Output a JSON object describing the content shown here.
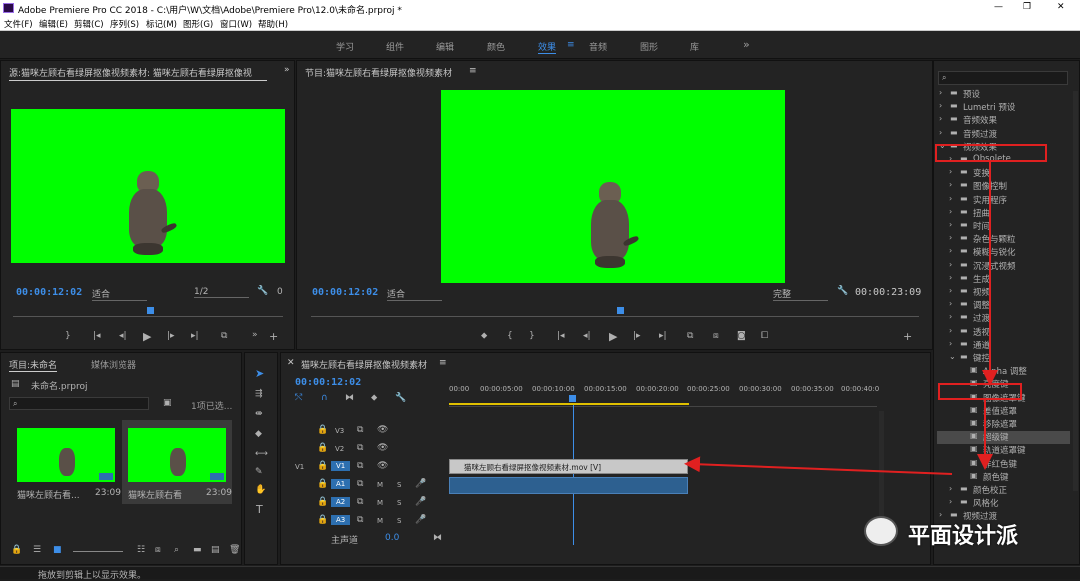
{
  "window": {
    "title": "Adobe Premiere Pro CC 2018 - C:\\用户\\W\\文档\\Adobe\\Premiere Pro\\12.0\\未命名.prproj *",
    "min": "—",
    "max": "❐",
    "close": "✕"
  },
  "menu": [
    "文件(F)",
    "编辑(E)",
    "剪辑(C)",
    "序列(S)",
    "标记(M)",
    "图形(G)",
    "窗口(W)",
    "帮助(H)"
  ],
  "workspaces": [
    "学习",
    "组件",
    "编辑",
    "颜色",
    "效果",
    "音频",
    "图形",
    "库"
  ],
  "workspace_more": "»",
  "active_workspace": "效果",
  "source": {
    "title": "源:猫咪左顾右看绿屏抠像视频素材: 猫咪左顾右看绿屏抠像视",
    "timecode": "00:00:12:02",
    "fit": "适合",
    "res": "1/2",
    "counter": "0"
  },
  "program": {
    "title": "节目:猫咪左顾右看绿屏抠像视频素材",
    "timecode": "00:00:12:02",
    "fit": "适合",
    "quality": "完整",
    "duration": "00:00:23:09"
  },
  "project": {
    "tab1": "项目:未命名",
    "tab2": "媒体浏览器",
    "file": "未命名.prproj",
    "selected": "1项已选...",
    "items": [
      {
        "name": "猫咪左顾右看...",
        "dur": "23:09"
      },
      {
        "name": "猫咪左顾右看",
        "dur": "23:09"
      }
    ]
  },
  "timeline": {
    "title": "猫咪左顾右看绿屏抠像视频素材",
    "timecode": "00:00:12:02",
    "ruler": [
      "00:00",
      "00:00:05:00",
      "00:00:10:00",
      "00:00:15:00",
      "00:00:20:00",
      "00:00:25:00",
      "00:00:30:00",
      "00:00:35:00",
      "00:00:40:0"
    ],
    "tracks": [
      "V3",
      "V2",
      "V1",
      "A1",
      "A2",
      "A3"
    ],
    "v1_label": "V1",
    "master": "主声道",
    "master_val": "0.0",
    "clip": "猫咪左顾右看绿屏抠像视频素材.mov [V]",
    "m": "M",
    "s": "S"
  },
  "effects": {
    "items": [
      {
        "label": "预设",
        "depth": 0
      },
      {
        "label": "Lumetri 预设",
        "depth": 0
      },
      {
        "label": "音频效果",
        "depth": 0
      },
      {
        "label": "音频过渡",
        "depth": 0
      },
      {
        "label": "视频效果",
        "depth": 0,
        "open": true
      },
      {
        "label": "Obsolete",
        "depth": 1
      },
      {
        "label": "变换",
        "depth": 1
      },
      {
        "label": "图像控制",
        "depth": 1
      },
      {
        "label": "实用程序",
        "depth": 1
      },
      {
        "label": "扭曲",
        "depth": 1
      },
      {
        "label": "时间",
        "depth": 1
      },
      {
        "label": "杂色与颗粒",
        "depth": 1
      },
      {
        "label": "模糊与锐化",
        "depth": 1
      },
      {
        "label": "沉浸式视频",
        "depth": 1
      },
      {
        "label": "生成",
        "depth": 1
      },
      {
        "label": "视频",
        "depth": 1
      },
      {
        "label": "调整",
        "depth": 1
      },
      {
        "label": "过渡",
        "depth": 1
      },
      {
        "label": "透视",
        "depth": 1
      },
      {
        "label": "通道",
        "depth": 1
      },
      {
        "label": "键控",
        "depth": 1,
        "open": true
      },
      {
        "label": "Alpha 调整",
        "depth": 2
      },
      {
        "label": "亮度键",
        "depth": 2
      },
      {
        "label": "图像遮罩键",
        "depth": 2
      },
      {
        "label": "差值遮罩",
        "depth": 2
      },
      {
        "label": "移除遮罩",
        "depth": 2
      },
      {
        "label": "超级键",
        "depth": 2,
        "selected": true
      },
      {
        "label": "轨道遮罩键",
        "depth": 2
      },
      {
        "label": "非红色键",
        "depth": 2
      },
      {
        "label": "颜色键",
        "depth": 2
      },
      {
        "label": "颜色校正",
        "depth": 1
      },
      {
        "label": "风格化",
        "depth": 1
      },
      {
        "label": "视频过渡",
        "depth": 0
      }
    ]
  },
  "status": "拖放到剪辑上以显示效果。",
  "watermark": "平面设计派",
  "colors": {
    "accent": "#2d8ceb",
    "green": "#00ff00",
    "red": "#e02020",
    "bg": "#232323"
  }
}
